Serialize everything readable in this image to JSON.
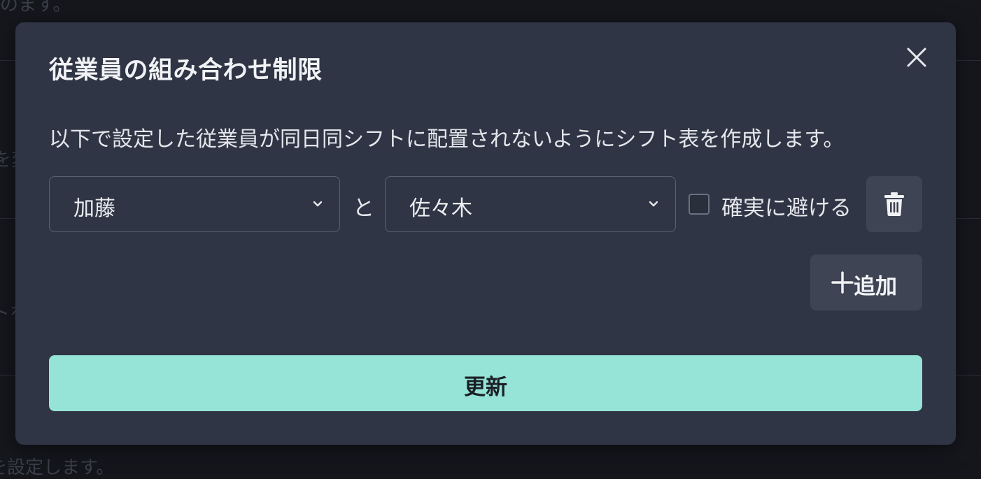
{
  "background": {
    "fragment_top": "のます。",
    "fragment_left_1": "を変",
    "fragment_left_2": "トを",
    "fragment_bottom": "を設定します。"
  },
  "modal": {
    "title": "従業員の組み合わせ制限",
    "close_icon": "close-icon",
    "description": "以下で設定した従業員が同日同シフトに配置されないようにシフト表を作成します。",
    "restriction": {
      "employee_a": "加藤",
      "conjunction": "と",
      "employee_b": "佐々木",
      "checkbox_label": "確実に避ける",
      "checkbox_checked": false,
      "delete_icon": "trash-icon"
    },
    "add_button_label": "追加",
    "submit_button_label": "更新"
  },
  "colors": {
    "modal_bg": "#2f3544",
    "button_bg": "#3e4453",
    "accent": "#96e3d7"
  }
}
